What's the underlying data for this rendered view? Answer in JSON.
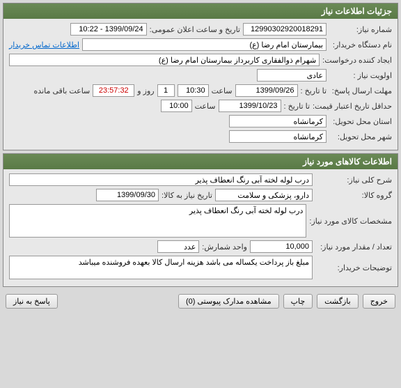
{
  "section1": {
    "title": "جزئیات اطلاعات نیاز",
    "need_number_label": "شماره نیاز:",
    "need_number": "12990302920018291",
    "announce_label": "تاریخ و ساعت اعلان عمومی:",
    "announce_value": "1399/09/24 - 10:22",
    "buyer_device_label": "نام دستگاه خریدار:",
    "buyer_device": "بیمارستان امام رضا (ع)",
    "contact_link": "اطلاعات تماس خریدار",
    "creator_label": "ایجاد کننده درخواست:",
    "creator": "شهرام ذوالفقاری کاربرداز بیمارستان امام رضا (ع)",
    "priority_label": "اولویت نیاز :",
    "priority": "عادی",
    "deadline_label": "مهلت ارسال پاسخ:",
    "until_label": "تا تاریخ :",
    "until_date": "1399/09/26",
    "time_label": "ساعت",
    "until_time": "10:30",
    "days_value": "1",
    "days_label": "روز و",
    "remaining_time": "23:57:32",
    "remaining_label": "ساعت باقی مانده",
    "min_credit_label": "حداقل تاریخ اعتبار قیمت:",
    "credit_until_label": "تا تاریخ :",
    "credit_date": "1399/10/23",
    "credit_time": "10:00",
    "province_label": "استان محل تحویل:",
    "province": "کرمانشاه",
    "city_label": "شهر محل تحویل:",
    "city": "کرمانشاه"
  },
  "section2": {
    "title": "اطلاعات کالاهای مورد نیاز",
    "desc_label": "شرح کلی نیاز:",
    "desc": "درب لوله لخته آبی رنگ انعطاف پذیر",
    "group_label": "گروه کالا:",
    "group": "دارو، پزشکی و سلامت",
    "need_date_label": "تاریخ نیاز به کالا:",
    "need_date": "1399/09/30",
    "spec_label": "مشخصات کالای مورد نیاز:",
    "spec": "درب لوله لخته آبی رنگ انعطاف پذیر",
    "qty_label": "تعداد / مقدار مورد نیاز:",
    "qty": "10,000",
    "unit_label": "واحد شمارش:",
    "unit": "عدد",
    "buyer_notes_label": "توضیحات خریدار:",
    "buyer_notes": "مبلغ باز پرداخت یکساله می باشد هزینه ارسال کالا بعهده فروشنده میباشد"
  },
  "buttons": {
    "respond": "پاسخ به نیاز",
    "attachments": "مشاهده مدارک پیوستی (0)",
    "print": "چاپ",
    "back": "بازگشت",
    "exit": "خروج"
  }
}
